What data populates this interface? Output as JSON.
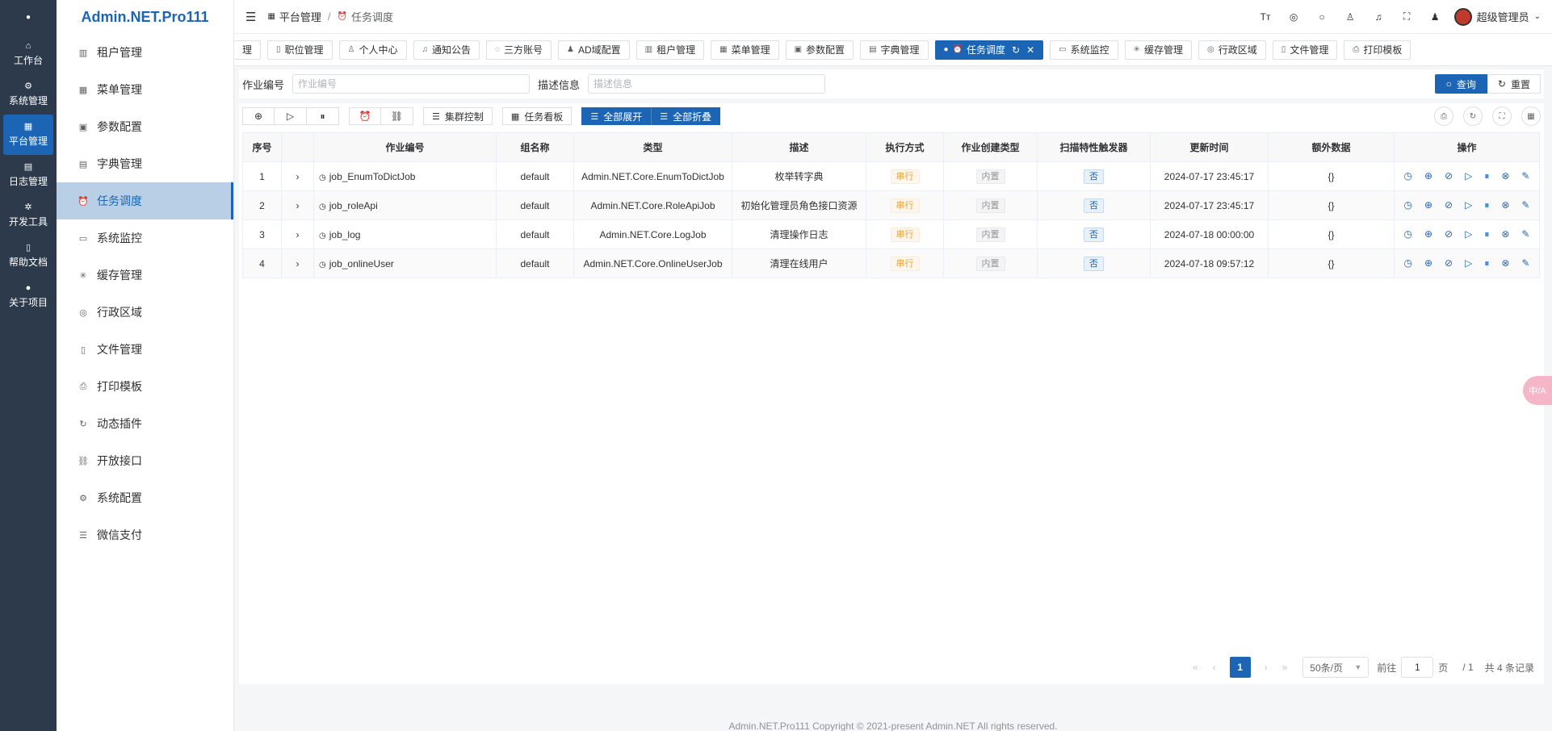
{
  "rail": {
    "items": [
      {
        "label": "工作台",
        "icon": "home-icon"
      },
      {
        "label": "系统管理",
        "icon": "settings-icon"
      },
      {
        "label": "平台管理",
        "icon": "grid-icon"
      },
      {
        "label": "日志管理",
        "icon": "document-icon"
      },
      {
        "label": "开发工具",
        "icon": "tools-icon"
      },
      {
        "label": "帮助文档",
        "icon": "book-icon"
      },
      {
        "label": "关于项目",
        "icon": "info-icon"
      }
    ]
  },
  "brand": "Admin.NET.Pro111",
  "submenu": {
    "items": [
      {
        "label": "租户管理"
      },
      {
        "label": "菜单管理"
      },
      {
        "label": "参数配置"
      },
      {
        "label": "字典管理"
      },
      {
        "label": "任务调度"
      },
      {
        "label": "系统监控"
      },
      {
        "label": "缓存管理"
      },
      {
        "label": "行政区域"
      },
      {
        "label": "文件管理"
      },
      {
        "label": "打印模板"
      },
      {
        "label": "动态插件"
      },
      {
        "label": "开放接口"
      },
      {
        "label": "系统配置"
      },
      {
        "label": "微信支付"
      }
    ]
  },
  "breadcrumb": {
    "parent": "平台管理",
    "sep": "/",
    "current": "任务调度"
  },
  "user": {
    "name": "超级管理员"
  },
  "tabs": [
    {
      "label": "理"
    },
    {
      "label": "职位管理"
    },
    {
      "label": "个人中心"
    },
    {
      "label": "通知公告"
    },
    {
      "label": "三方账号"
    },
    {
      "label": "AD域配置"
    },
    {
      "label": "租户管理"
    },
    {
      "label": "菜单管理"
    },
    {
      "label": "参数配置"
    },
    {
      "label": "字典管理"
    },
    {
      "label": "任务调度"
    },
    {
      "label": "系统监控"
    },
    {
      "label": "缓存管理"
    },
    {
      "label": "行政区域"
    },
    {
      "label": "文件管理"
    },
    {
      "label": "打印模板"
    }
  ],
  "search": {
    "job_label": "作业编号",
    "job_placeholder": "作业编号",
    "desc_label": "描述信息",
    "desc_placeholder": "描述信息",
    "query_label": "查询",
    "reset_label": "重置"
  },
  "toolbar": {
    "cluster_label": "集群控制",
    "board_label": "任务看板",
    "expand_all_label": "全部展开",
    "collapse_all_label": "全部折叠"
  },
  "table": {
    "columns": [
      "序号",
      "",
      "作业编号",
      "组名称",
      "类型",
      "描述",
      "执行方式",
      "作业创建类型",
      "扫描特性触发器",
      "更新时间",
      "额外数据",
      "操作"
    ],
    "rows": [
      {
        "index": "1",
        "job_id": "job_EnumToDictJob",
        "group": "default",
        "type": "Admin.NET.Core.EnumToDictJob",
        "desc": "枚举转字典",
        "exec": "串行",
        "create_type": "内置",
        "scan": "否",
        "updated": "2024-07-17 23:45:17",
        "extra": "{}"
      },
      {
        "index": "2",
        "job_id": "job_roleApi",
        "group": "default",
        "type": "Admin.NET.Core.RoleApiJob",
        "desc": "初始化管理员角色接口资源",
        "exec": "串行",
        "create_type": "内置",
        "scan": "否",
        "updated": "2024-07-17 23:45:17",
        "extra": "{}"
      },
      {
        "index": "3",
        "job_id": "job_log",
        "group": "default",
        "type": "Admin.NET.Core.LogJob",
        "desc": "清理操作日志",
        "exec": "串行",
        "create_type": "内置",
        "scan": "否",
        "updated": "2024-07-18 00:00:00",
        "extra": "{}"
      },
      {
        "index": "4",
        "job_id": "job_onlineUser",
        "group": "default",
        "type": "Admin.NET.Core.OnlineUserJob",
        "desc": "清理在线用户",
        "exec": "串行",
        "create_type": "内置",
        "scan": "否",
        "updated": "2024-07-18 09:57:12",
        "extra": "{}"
      }
    ]
  },
  "pagination": {
    "current_page": "1",
    "page_size": "50条/页",
    "goto_label": "前往",
    "goto_value": "1",
    "page_unit": "页",
    "total_pages": "/ 1",
    "total_label": "共 4 条记录"
  },
  "footer": "Admin.NET.Pro111 Copyright © 2021-present Admin.NET All rights reserved.",
  "float_button": "中/A",
  "colors": {
    "primary": "#1c65b4",
    "rail_bg": "#2d3a4b",
    "submenu_active_bg": "#b8cfe6"
  }
}
